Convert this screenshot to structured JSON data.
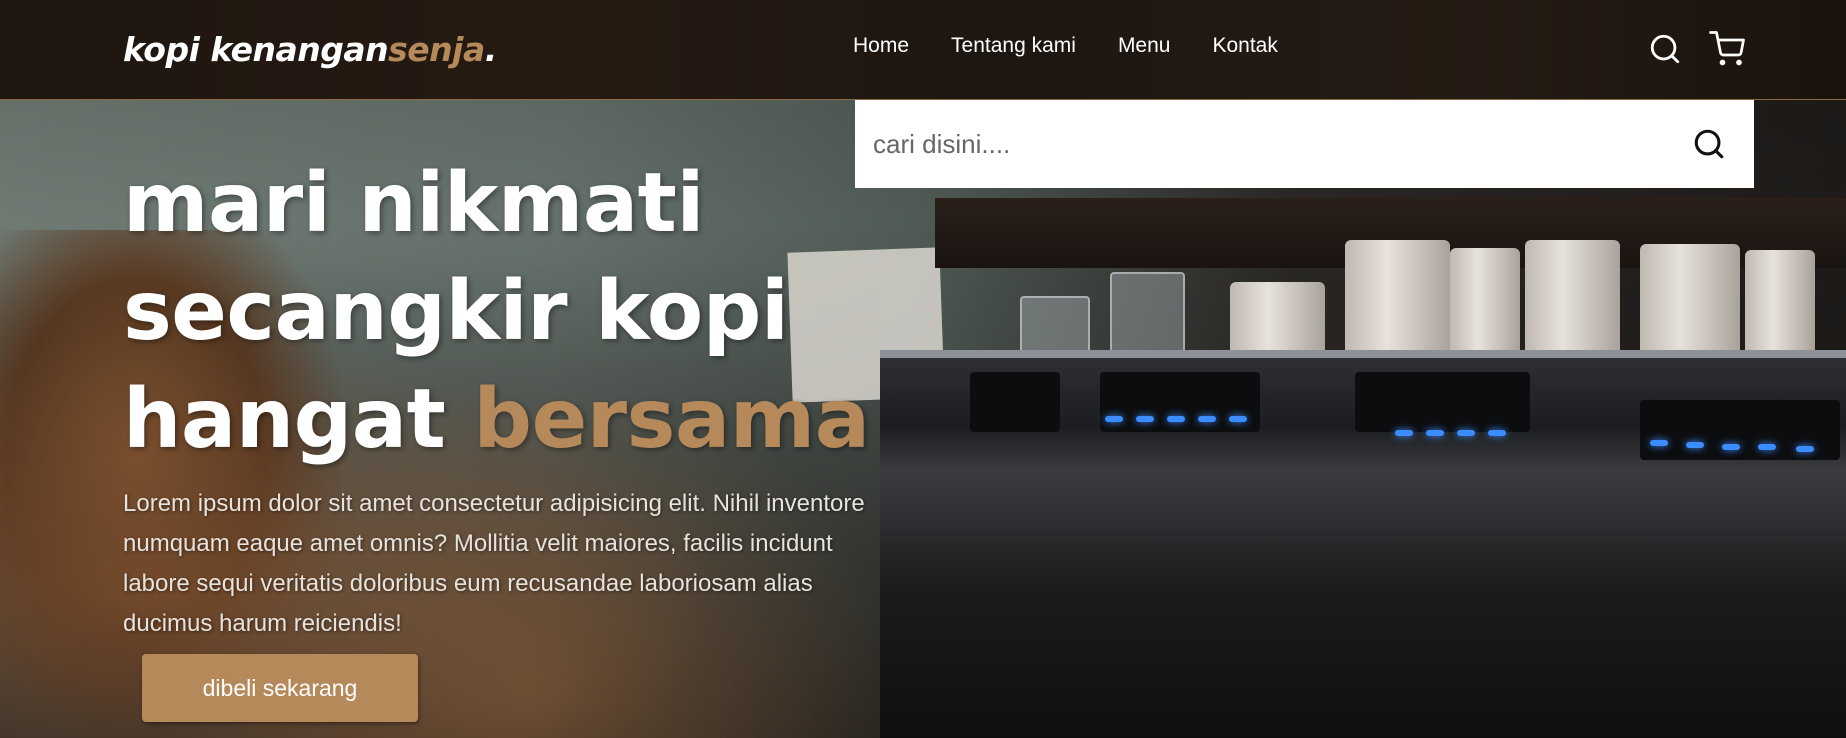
{
  "brand": {
    "logo_main": "kopi kenangan",
    "logo_accent": "senja",
    "logo_dot": "."
  },
  "nav": {
    "items": [
      {
        "label": "Home"
      },
      {
        "label": "Tentang kami"
      },
      {
        "label": "Menu"
      },
      {
        "label": "Kontak"
      }
    ],
    "icons": [
      "search-icon",
      "cart-icon"
    ]
  },
  "search": {
    "placeholder": "cari disini....",
    "value": ""
  },
  "hero": {
    "title_line1": "mari nikmati",
    "title_line2": "secangkir kopi",
    "title_line3_plain": "hangat ",
    "title_line3_accent": "bersama",
    "description": "Lorem ipsum dolor sit amet consectetur adipisicing elit. Nihil inventore numquam eaque amet omnis? Mollitia velit maiores, facilis incidunt labore sequi veritatis doloribus eum recusandae laboriosam alias ducimus harum reiciendis!",
    "cta_label": "dibeli sekarang"
  },
  "colors": {
    "accent": "#b6895b",
    "text": "#ffffff",
    "search_bg": "#ffffff"
  }
}
